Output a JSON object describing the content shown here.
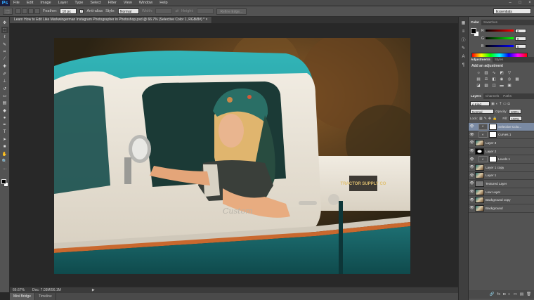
{
  "app": {
    "logo": "Ps",
    "menu": [
      "File",
      "Edit",
      "Image",
      "Layer",
      "Type",
      "Select",
      "Filter",
      "View",
      "Window",
      "Help"
    ],
    "window_controls": [
      "–",
      "□",
      "×"
    ]
  },
  "options_bar": {
    "feather_label": "Feather:",
    "feather_value": "10 px",
    "anti_alias_label": "Anti-alias",
    "style_label": "Style:",
    "style_value": "Normal",
    "width_label": "Width:",
    "height_label": "Height:",
    "refine_edge_label": "Refine Edge...",
    "workspace": "Essentials"
  },
  "document": {
    "tab_title": "Learn How to Edit Like Markwingerman Instagram Photographer in Photoshop.psd @ 66.7% (Selective Color 1, RGB/8#) *",
    "tab_close": "×"
  },
  "status_bar": {
    "zoom": "66.67%",
    "doc_size": "Doc: 7.03M/56.1M",
    "arrow": "▶"
  },
  "bottom_tabs": [
    "Mini Bridge",
    "Timeline"
  ],
  "color_panel": {
    "tabs": [
      "Color",
      "Swatches"
    ],
    "sliders": [
      {
        "label": "R",
        "value": "0",
        "gradient": "linear-gradient(to right,#000,#ff0000)"
      },
      {
        "label": "G",
        "value": "0",
        "gradient": "linear-gradient(to right,#000,#00ff00)"
      },
      {
        "label": "B",
        "value": "0",
        "gradient": "linear-gradient(to right,#000,#0000ff)"
      }
    ]
  },
  "adjustments_panel": {
    "tabs": [
      "Adjustments",
      "Styles"
    ],
    "title": "Add an adjustment"
  },
  "layers_panel": {
    "tabs": [
      "Layers",
      "Channels",
      "Paths"
    ],
    "kind_filter": "ρ Kind",
    "blend_mode": "Normal",
    "opacity_label": "Opacity:",
    "opacity_value": "100%",
    "lock_label": "Lock:",
    "fill_label": "Fill:",
    "fill_value": "100%",
    "layers": [
      {
        "name": "Selective Colo...",
        "thumb": "adj",
        "mask": true,
        "selected": true,
        "indent": true
      },
      {
        "name": "Curves 1",
        "thumb": "adj",
        "mask": true,
        "selected": false,
        "indent": true
      },
      {
        "name": "Layer 3",
        "thumb": "img",
        "mask": false,
        "selected": false,
        "indent": false
      },
      {
        "name": "Layer 2",
        "thumb": "ellipse",
        "mask": false,
        "selected": false,
        "indent": false
      },
      {
        "name": "Levels 1",
        "thumb": "adj",
        "mask": true,
        "selected": false,
        "indent": true
      },
      {
        "name": "Layer 1 copy",
        "thumb": "img",
        "mask": false,
        "selected": false,
        "indent": false
      },
      {
        "name": "Layer 1",
        "thumb": "img",
        "mask": false,
        "selected": false,
        "indent": false
      },
      {
        "name": "Textured Layer",
        "thumb": "gray",
        "mask": false,
        "selected": false,
        "indent": false
      },
      {
        "name": "Low Layer",
        "thumb": "img",
        "mask": false,
        "selected": false,
        "indent": false
      },
      {
        "name": "Background copy",
        "thumb": "img",
        "mask": false,
        "selected": false,
        "indent": false
      },
      {
        "name": "Background",
        "thumb": "img",
        "mask": false,
        "selected": false,
        "indent": false
      }
    ],
    "footer_icons": [
      "🔗",
      "fx",
      "◘",
      "◐",
      "▭",
      "▤",
      "🗑"
    ]
  },
  "image": {
    "badge_text": "TRACTOR SUPPLY CO",
    "truck_script": "Custom"
  }
}
